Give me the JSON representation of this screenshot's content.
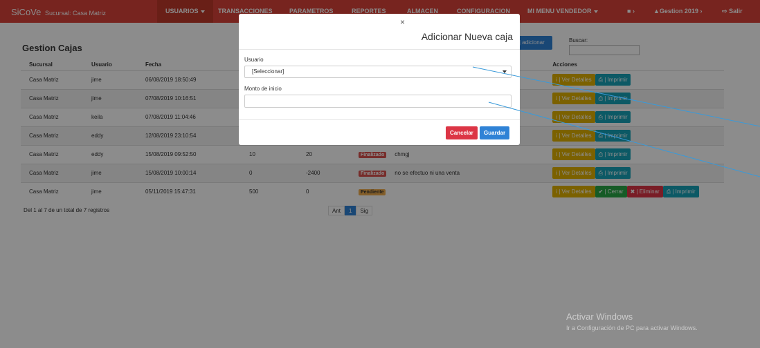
{
  "navbar": {
    "brand": "SiCoVe",
    "brand_sub": "Sucursal: Casa Matriz",
    "items": [
      {
        "label": "USUARIOS"
      },
      {
        "label": "TRANSACCIONES"
      },
      {
        "label": "PARAMETROS"
      },
      {
        "label": "REPORTES"
      },
      {
        "label": "ALMACEN"
      },
      {
        "label": "CONFIGURACION"
      }
    ],
    "menu_vendedor": "MI MENU VENDEDOR",
    "lock_icon": "lock-icon",
    "gestion": "Gestion 2019",
    "salir": "Salir",
    "color": "#d9423a"
  },
  "page": {
    "title": "Gestion Cajas",
    "add_button": "| adicionar",
    "search_label": "Buscar:"
  },
  "table": {
    "headers": [
      "Sucursal",
      "Usuario",
      "Fecha",
      "",
      "",
      "",
      "",
      "Acciones"
    ],
    "rows": [
      {
        "sucursal": "Casa Matriz",
        "usuario": "jime",
        "fecha": "06/08/2019 18:50:49",
        "inicio": "",
        "cierre": "",
        "estado": "",
        "obs": ""
      },
      {
        "sucursal": "Casa Matriz",
        "usuario": "jime",
        "fecha": "07/08/2019 10:16:51",
        "inicio": "",
        "cierre": "",
        "estado": "",
        "obs": ""
      },
      {
        "sucursal": "Casa Matriz",
        "usuario": "keila",
        "fecha": "07/08/2019 11:04:46",
        "inicio": "",
        "cierre": "",
        "estado": "",
        "obs": ""
      },
      {
        "sucursal": "Casa Matriz",
        "usuario": "eddy",
        "fecha": "12/08/2019 23:10:54",
        "inicio": "",
        "cierre": "",
        "estado": "",
        "obs": ""
      },
      {
        "sucursal": "Casa Matriz",
        "usuario": "eddy",
        "fecha": "15/08/2019 09:52:50",
        "inicio": "10",
        "cierre": "20",
        "estado": "Finalizado",
        "obs": "chmgj"
      },
      {
        "sucursal": "Casa Matriz",
        "usuario": "jime",
        "fecha": "15/08/2019 10:00:14",
        "inicio": "0",
        "cierre": "-2400",
        "estado": "Finalizado",
        "obs": "no se efectuo ni una venta"
      },
      {
        "sucursal": "Casa Matriz",
        "usuario": "jime",
        "fecha": "05/11/2019 15:47:31",
        "inicio": "500",
        "cierre": "0",
        "estado": "Pendiente",
        "obs": ""
      }
    ],
    "actions": {
      "detalles": "i | Ver Detalles",
      "imprimir": "⎙ | Imprimir",
      "cerrar": "✔ | Cerrar",
      "eliminar": "✖ | Eliminar"
    }
  },
  "footer": {
    "count": "Del 1 al 7 de un total de 7 registros",
    "prev": "Ant",
    "page": "1",
    "next": "Sig"
  },
  "modal": {
    "close": "×",
    "title": "Adicionar Nueva caja",
    "usuario_label": "Usuario",
    "usuario_value": "[Seleccionar]",
    "monto_label": "Monto de inicio",
    "monto_value": "",
    "cancel": "Cancelar",
    "save": "Guardar"
  },
  "watermark": {
    "line1": "Activar Windows",
    "line2": "Ir a Configuración de PC para activar Windows."
  }
}
